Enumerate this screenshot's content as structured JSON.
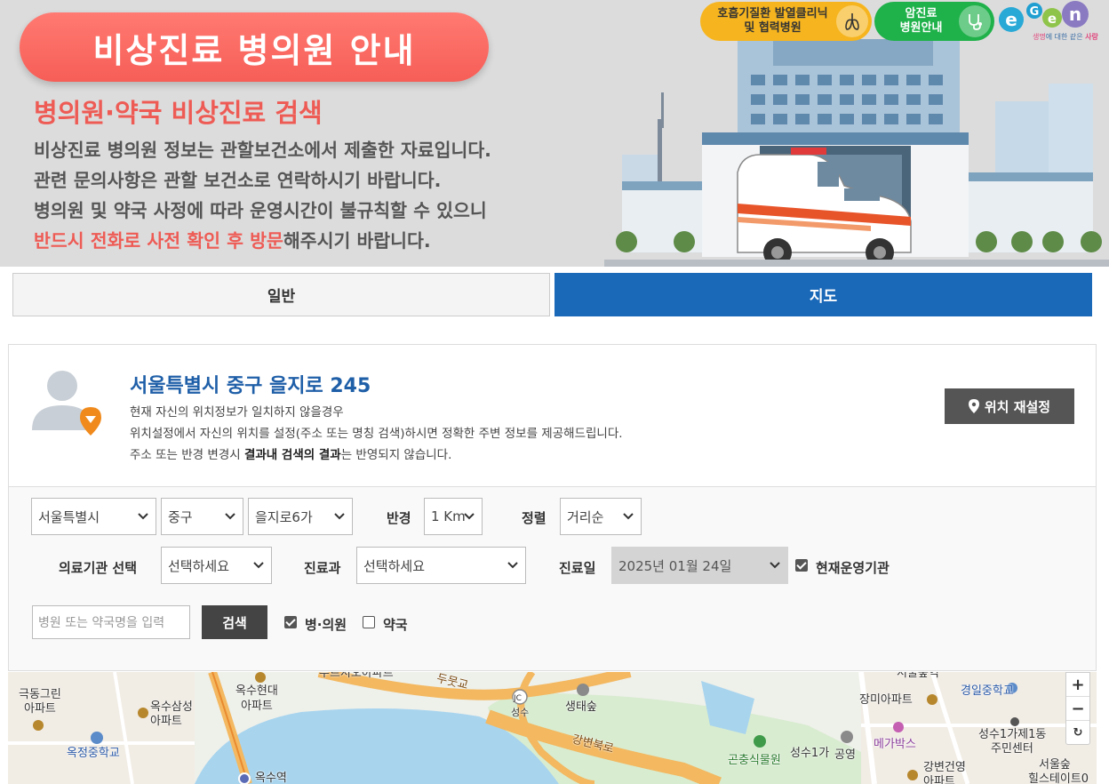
{
  "banner": {
    "title": "비상진료 병의원 안내",
    "subtitle": "병의원·약국 비상진료 검색",
    "desc_line1": "비상진료 병의원 정보는 관할보건소에서 제출한 자료입니다.",
    "desc_line2": "관련 문의사항은 관할 보건소로 연락하시기 바랍니다.",
    "desc_line3": "병의원 및 약국 사정에 따라 운영시간이 불규칙할 수 있으니",
    "desc_line4_red": "반드시 전화로 사전 확인 후 방문",
    "desc_line4_rest": "해주시기 바랍니다.",
    "respiratory_btn_line1": "호흡기질환 발열클리닉",
    "respiratory_btn_line2": "및 협력병원",
    "cancer_btn_line1": "암진료",
    "cancer_btn_line2": "병원안내",
    "logo_text": "E-Gen",
    "logo_tagline_a": "생명",
    "logo_tagline_b": "에 대한 같은 ",
    "logo_tagline_c": "사랑",
    "colors": {
      "pill": "#f65e57",
      "subtitle": "#ee5b55",
      "yellow": "#f6b51f",
      "green": "#1fb14a"
    }
  },
  "tabs": {
    "general": "일반",
    "map": "지도",
    "active": "지도",
    "active_color": "#1a68b8"
  },
  "location": {
    "address": "서울특별시 중구 을지로 245",
    "line1": "현재 자신의 위치정보가 일치하지 않을경우",
    "line2": "위치설정에서 자신의 위치를 설정(주소 또는 명칭 검색)하시면 정확한 주변 정보를 제공해드립니다.",
    "line3_pre": "주소 또는 반경 변경시 ",
    "line3_bold": "결과내 검색의 결과",
    "line3_post": "는 반영되지 않습니다.",
    "relocate_label": "위치 재설정"
  },
  "filters": {
    "city": "서울특별시",
    "district": "중구",
    "dong": "을지로6가",
    "radius_label": "반경",
    "radius": "1 Km",
    "sort_label": "정렬",
    "sort": "거리순",
    "institution_label": "의료기관 선택",
    "institution": "선택하세요",
    "department_label": "진료과",
    "department": "선택하세요",
    "date_label": "진료일",
    "date": "2025년 01월 24일",
    "currently_open_label": "현재운영기관",
    "currently_open": true,
    "search_placeholder": "병원 또는 약국명을 입력",
    "search_button": "검색",
    "hospital_label": "병·의원",
    "hospital_checked": true,
    "pharmacy_label": "약국",
    "pharmacy_checked": false
  },
  "map": {
    "zoom_in": "+",
    "zoom_out": "−",
    "reset": "↻",
    "labels": {
      "gukdong": "극동그린",
      "gukdong2": "아파트",
      "oksu_hyundai": "옥수현대",
      "oksu_hyundai2": "아파트",
      "oksu_samsung": "옥수삼성",
      "oksu_samsung2": "아파트",
      "okjeong_ms": "옥정중학교",
      "oksu_station": "옥수역",
      "dumo": "두뭇교",
      "seongsu_jc": "성수",
      "jc": "JC",
      "forest": "생태숲",
      "gangbyeon_road": "강변북로",
      "seongsu_1ga": "성수1가",
      "gonchung": "곤충식물원",
      "park": "공영",
      "seoul_forest_top": "서울숲역",
      "gyeongil_ms": "경일중학교",
      "jangmi": "장미아파트",
      "megabox": "메가박스",
      "seongsu_center": "성수1가제1동",
      "seongsu_center2": "주민센터",
      "gangbyeon_apt": "강변건영",
      "gangbyeon_apt2": "아파트",
      "seoul_forest_hills": "서울숲",
      "seoul_forest_hills2": "힐스테이트0",
      "top_apt": "푸르지오아파트"
    }
  }
}
